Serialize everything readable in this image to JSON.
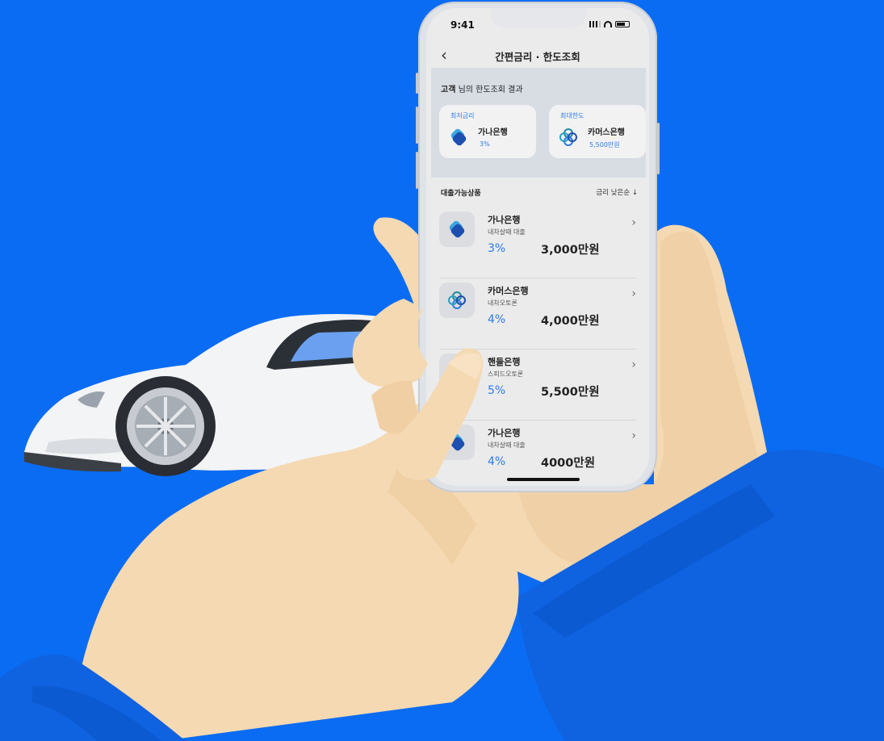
{
  "status": {
    "time": "9:41"
  },
  "header": {
    "title": "간편금리 · 한도조회",
    "back_icon": "chevron-left-icon"
  },
  "result": {
    "customer": "고객",
    "title_suffix": " 님의 한도조회 결과",
    "cards": [
      {
        "label": "최저금리",
        "bank": "가나은행",
        "value": "3%",
        "icon": "bank-logo-blue-icon"
      },
      {
        "label": "최대한도",
        "bank": "카머스은행",
        "value": "5,500만원",
        "icon": "bank-logo-rings-icon"
      }
    ]
  },
  "list": {
    "title": "대출가능상품",
    "sort_label": "금리 낮은순 ↓",
    "items": [
      {
        "bank": "가나은행",
        "product": "내차살때 대출",
        "rate": "3%",
        "amount": "3,000만원",
        "icon": "bank-logo-blue-icon"
      },
      {
        "bank": "카머스은행",
        "product": "내차오토론",
        "rate": "4%",
        "amount": "4,000만원",
        "icon": "bank-logo-rings-icon"
      },
      {
        "bank": "핸들은행",
        "product": "스피드오토론",
        "rate": "5%",
        "amount": "5,500만원",
        "icon": "bank-logo-blue-icon"
      },
      {
        "bank": "가나은행",
        "product": "내차살때 대출",
        "rate": "4%",
        "amount": "4000만원",
        "icon": "bank-logo-blue-icon"
      }
    ]
  },
  "colors": {
    "background": "#0a6cf2",
    "accent": "#2c7be5",
    "sleeve": "#0f62e0",
    "hand": "#f4d9b2"
  }
}
